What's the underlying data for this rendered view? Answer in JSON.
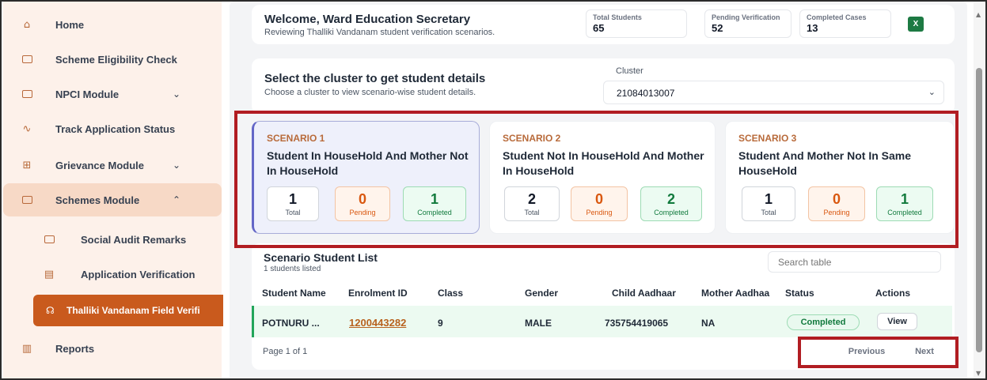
{
  "sidebar": {
    "items": [
      {
        "label": "Home",
        "icon": "home-icon"
      },
      {
        "label": "Scheme Eligibility Check",
        "icon": "folder-icon"
      },
      {
        "label": "NPCI Module",
        "icon": "folder-icon",
        "chevron": "⌄"
      },
      {
        "label": "Track Application Status",
        "icon": "pulse-icon"
      },
      {
        "label": "Grievance Module",
        "icon": "grid-icon",
        "chevron": "⌄"
      },
      {
        "label": "Schemes Module",
        "icon": "folder-icon",
        "chevron": "⌃"
      }
    ],
    "sub_items": [
      {
        "label": "Social Audit Remarks",
        "icon": "folder-icon"
      },
      {
        "label": "Application Verification",
        "icon": "document-icon"
      },
      {
        "label": "Thalliki Vandanam Field Verifi",
        "icon": "graduation-cap-icon"
      }
    ],
    "reports": {
      "label": "Reports",
      "icon": "bar-chart-icon"
    }
  },
  "welcome": {
    "title": "Welcome, Ward Education Secretary",
    "subtitle": "Reviewing Thalliki Vandanam student verification scenarios."
  },
  "stats": [
    {
      "label": "Total Students",
      "value": "65"
    },
    {
      "label": "Pending Verification",
      "value": "52"
    },
    {
      "label": "Completed Cases",
      "value": "13"
    }
  ],
  "excel_icon_text": "X",
  "cluster": {
    "title": "Select the cluster to get student details",
    "subtitle": "Choose a cluster to view scenario-wise student details.",
    "label": "Cluster",
    "value": "21084013007"
  },
  "scenarios": [
    {
      "tag": "SCENARIO 1",
      "title": "Student In HouseHold And Mother Not In HouseHold",
      "total": "1",
      "pending": "0",
      "completed": "1"
    },
    {
      "tag": "SCENARIO 2",
      "title": "Student Not In HouseHold And Mother In HouseHold",
      "total": "2",
      "pending": "0",
      "completed": "2"
    },
    {
      "tag": "SCENARIO 3",
      "title": "Student And Mother Not In Same HouseHold",
      "total": "1",
      "pending": "0",
      "completed": "1"
    }
  ],
  "mini_labels": {
    "total": "Total",
    "pending": "Pending",
    "completed": "Completed"
  },
  "list": {
    "title": "Scenario Student List",
    "subtitle": "1 students listed",
    "search_placeholder": "Search table"
  },
  "table": {
    "headers": [
      "Student Name",
      "Enrolment ID",
      "Class",
      "Gender",
      "Child Aadhaar",
      "Mother Aadhaa",
      "Status",
      "Actions"
    ],
    "rows": [
      {
        "name": "POTNURU ...",
        "enrolment_id": "1200443282",
        "class": "9",
        "gender": "MALE",
        "child_aadhaar": "735754419065",
        "mother_aadhaar": "NA",
        "status": "Completed",
        "action": "View"
      }
    ]
  },
  "pagination": {
    "info": "Page 1 of 1",
    "previous": "Previous",
    "next": "Next"
  },
  "colors": {
    "accent": "#c95a1d",
    "highlight": "#b11d22",
    "selected_scenario": "#6366c7"
  }
}
